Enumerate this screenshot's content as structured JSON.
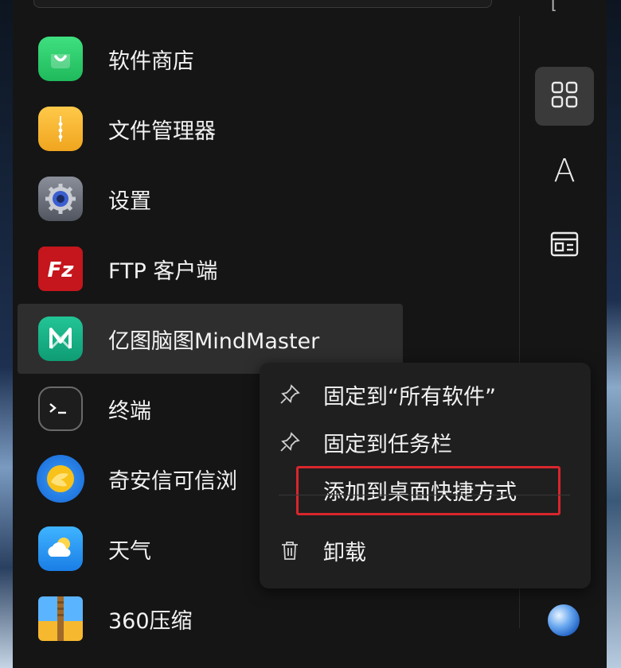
{
  "apps": [
    {
      "label": "软件商店",
      "icon": "store-bag-icon",
      "color": "#2ecc71"
    },
    {
      "label": "文件管理器",
      "icon": "folder-icon",
      "color": "#f5b82e"
    },
    {
      "label": "设置",
      "icon": "gear-icon",
      "color": "#6a6f7a"
    },
    {
      "label": "FTP 客户端",
      "icon": "filezilla-icon",
      "color": "#c4161c"
    },
    {
      "label": "亿图脑图MindMaster",
      "icon": "mindmaster-icon",
      "color": "#18b48a"
    },
    {
      "label": "终端",
      "icon": "terminal-icon",
      "color": "#2b2b2b"
    },
    {
      "label": "奇安信可信浏",
      "icon": "browser-icon",
      "color": "#1e78e6"
    },
    {
      "label": "天气",
      "icon": "weather-icon",
      "color": "#2a9df4"
    },
    {
      "label": "360压缩",
      "icon": "archive-icon",
      "color": "#4aa3f0"
    }
  ],
  "top_glyph": "[",
  "sidebar": {
    "buttons": [
      {
        "name": "all-apps",
        "icon": "grid-icon",
        "active": true
      },
      {
        "name": "alphabetical",
        "icon": "letter-a-icon",
        "glyph": "A",
        "active": false
      },
      {
        "name": "category",
        "icon": "category-card-icon",
        "active": false
      }
    ]
  },
  "context_menu": {
    "items": [
      {
        "label": "固定到“所有软件”",
        "icon": "pin-icon"
      },
      {
        "label": "固定到任务栏",
        "icon": "pin-icon"
      },
      {
        "label": "添加到桌面快捷方式",
        "icon": "",
        "highlighted": true
      },
      {
        "label": "卸载",
        "icon": "trash-icon"
      }
    ],
    "highlight_color": "#d8262c"
  }
}
